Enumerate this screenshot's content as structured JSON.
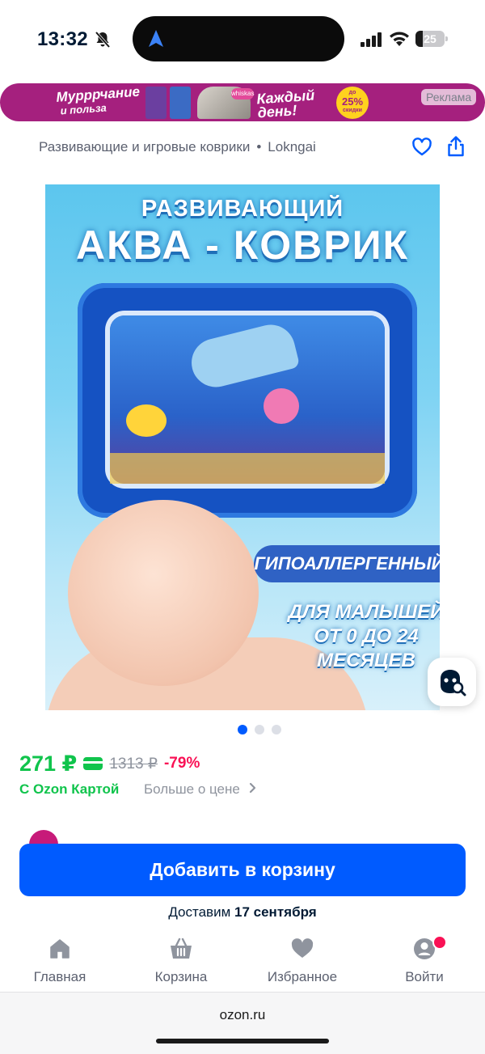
{
  "status_bar": {
    "time": "13:32",
    "battery_percent": "25",
    "battery_level": 0.25,
    "icons": [
      "bell-slash-icon",
      "location-arrow-icon",
      "cellular-signal-icon",
      "wifi-icon",
      "battery-icon"
    ]
  },
  "ad": {
    "tagline_line1": "Мурррчание",
    "tagline_line2": "и польза",
    "brand": "whiskas",
    "offer": "Каждый день!",
    "discount_pre": "до",
    "discount_value": "25%",
    "discount_post": "скидки",
    "label": "Реклама",
    "background_color": "#a5207e"
  },
  "breadcrumb": {
    "category": "Развивающие и игровые коврики",
    "separator": "•",
    "brand": "Lokngai"
  },
  "product_image": {
    "title_line1": "РАЗВИВАЮЩИЙ",
    "title_line2": "АКВА - КОВРИК",
    "badge1": "ГИПОАЛЛЕРГЕННЫЙ",
    "badge2_line1": "ДЛЯ МАЛЫШЕЙ",
    "badge2_line2": "ОТ 0 ДО 24",
    "badge2_line3": "МЕСЯЦЕВ",
    "carousel_total": 3,
    "carousel_active": 1
  },
  "price": {
    "current": "271 ₽",
    "old": "1313 ₽",
    "discount": "-79%",
    "card_label": "С Ozon Картой",
    "more_label": "Больше о цене",
    "price_color": "#10c44c",
    "discount_color": "#f91155"
  },
  "cart": {
    "button_label": "Добавить в корзину",
    "delivery_prefix": "Доставим",
    "delivery_date": "17 сентября",
    "button_color": "#005bff"
  },
  "tabs": [
    {
      "label": "Главная",
      "icon": "home-icon"
    },
    {
      "label": "Корзина",
      "icon": "basket-icon"
    },
    {
      "label": "Избранное",
      "icon": "heart-icon"
    },
    {
      "label": "Войти",
      "icon": "profile-icon"
    }
  ],
  "browser": {
    "url": "ozon.ru"
  }
}
